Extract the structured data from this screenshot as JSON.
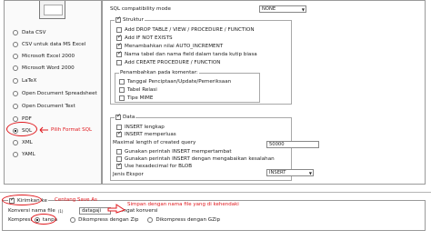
{
  "formats": [
    {
      "label": "Data CSV",
      "selected": false
    },
    {
      "label": "CSV untuk data MS Excel",
      "selected": false
    },
    {
      "label": "Microsoft Excel 2000",
      "selected": false
    },
    {
      "label": "Microsoft Word 2000",
      "selected": false
    },
    {
      "label": "LaTeX",
      "selected": false
    },
    {
      "label": "Open Document Spreadsheet",
      "selected": false
    },
    {
      "label": "Open Document Text",
      "selected": false
    },
    {
      "label": "PDF",
      "selected": false
    },
    {
      "label": "SQL",
      "selected": true
    },
    {
      "label": "XML",
      "selected": false
    },
    {
      "label": "YAML",
      "selected": false
    }
  ],
  "options": {
    "compat_label": "SQL compatibility mode",
    "compat_value": "NONE",
    "struktur": {
      "legend": "Struktur",
      "items": [
        {
          "label": "Add DROP TABLE / VIEW / PROCEDURE / FUNCTION",
          "checked": false
        },
        {
          "label": "Add IF NOT EXISTS",
          "checked": true
        },
        {
          "label": "Menambahkan nilai AUTO_INCREMENT",
          "checked": true
        },
        {
          "label": "Nama tabel dan nama field dalam tanda kutip biasa",
          "checked": true
        },
        {
          "label": "Add CREATE PROCEDURE / FUNCTION",
          "checked": false
        }
      ],
      "comments_legend": "Penambahkan pada komentar:",
      "comments": [
        {
          "label": "Tanggal Penciptaan/Update/Pemeriksaan",
          "checked": false
        },
        {
          "label": "Tabel Relasi",
          "checked": false
        },
        {
          "label": "Tipe MIME",
          "checked": false
        }
      ]
    },
    "data": {
      "legend": "Data",
      "items": [
        {
          "label": "INSERT lengkap",
          "checked": false
        },
        {
          "label": "INSERT memperluas",
          "checked": true
        }
      ],
      "max_query_label": "Maximal length of created query",
      "max_query_value": "50000",
      "items2": [
        {
          "label": "Gunakan perintah INSERT mempertambat",
          "checked": false
        },
        {
          "label": "Gunakan perintah INSERT dengan mengabaikan kesalahan",
          "checked": false
        },
        {
          "label": "Use hexadecimal for BLOB",
          "checked": true
        }
      ],
      "export_type_label": "Jenis Ekspor",
      "export_type_value": "INSERT"
    }
  },
  "send": {
    "label": "Kirimkan ke",
    "checked": true,
    "filename_label": "Konversi nama file",
    "filename_sup": "(1)",
    "filename_value": "datagaji",
    "remember_label": "ingat konversi",
    "remember_checked": true,
    "compression_label": "Kompresi",
    "compression_options": [
      {
        "label": "tanpa",
        "selected": true
      },
      {
        "label": "Dikompress dengan Zip",
        "selected": false
      },
      {
        "label": "Dikompress dengan GZip",
        "selected": false
      }
    ]
  },
  "annotations": {
    "pilih_sql": "Pilih Format SQL",
    "centang_save": "Centang Save As",
    "simpan_nama": "Simpan dengan nama file yang di kehendaki"
  },
  "colors": {
    "annotation": "#e0191e",
    "panel_border": "#9a9a9a"
  }
}
